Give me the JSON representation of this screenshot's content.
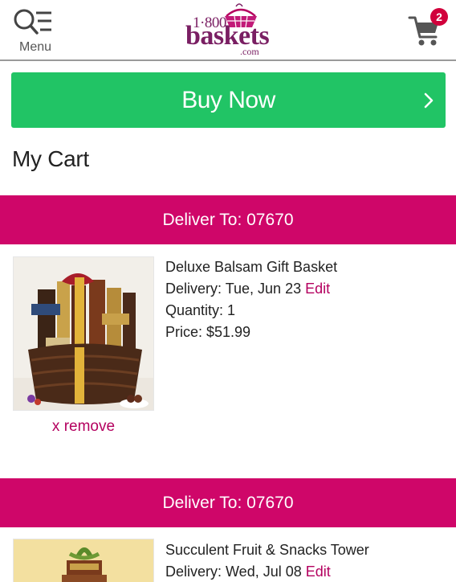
{
  "header": {
    "menu_label": "Menu",
    "logo": {
      "prefix": "1·800",
      "name": "baskets",
      "suffix": ".com"
    },
    "cart_count": "2"
  },
  "buy_now_label": "Buy Now",
  "cart_title": "My Cart",
  "colors": {
    "brand": "#cf0669",
    "buy_now": "#21c465",
    "link": "#b4005f",
    "logo": "#7a1f63",
    "badge": "#d1003b"
  },
  "items": [
    {
      "deliver_to": "Deliver To: 07670",
      "name": "Deluxe Balsam Gift Basket",
      "delivery": "Delivery: Tue, Jun 23",
      "edit_label": "Edit",
      "quantity": "Quantity: 1",
      "price": "Price: $51.99",
      "remove_label": "x remove"
    },
    {
      "deliver_to": "Deliver To: 07670",
      "name": "Succulent Fruit & Snacks Tower",
      "delivery": "Delivery: Wed, Jul 08",
      "edit_label": "Edit"
    }
  ]
}
